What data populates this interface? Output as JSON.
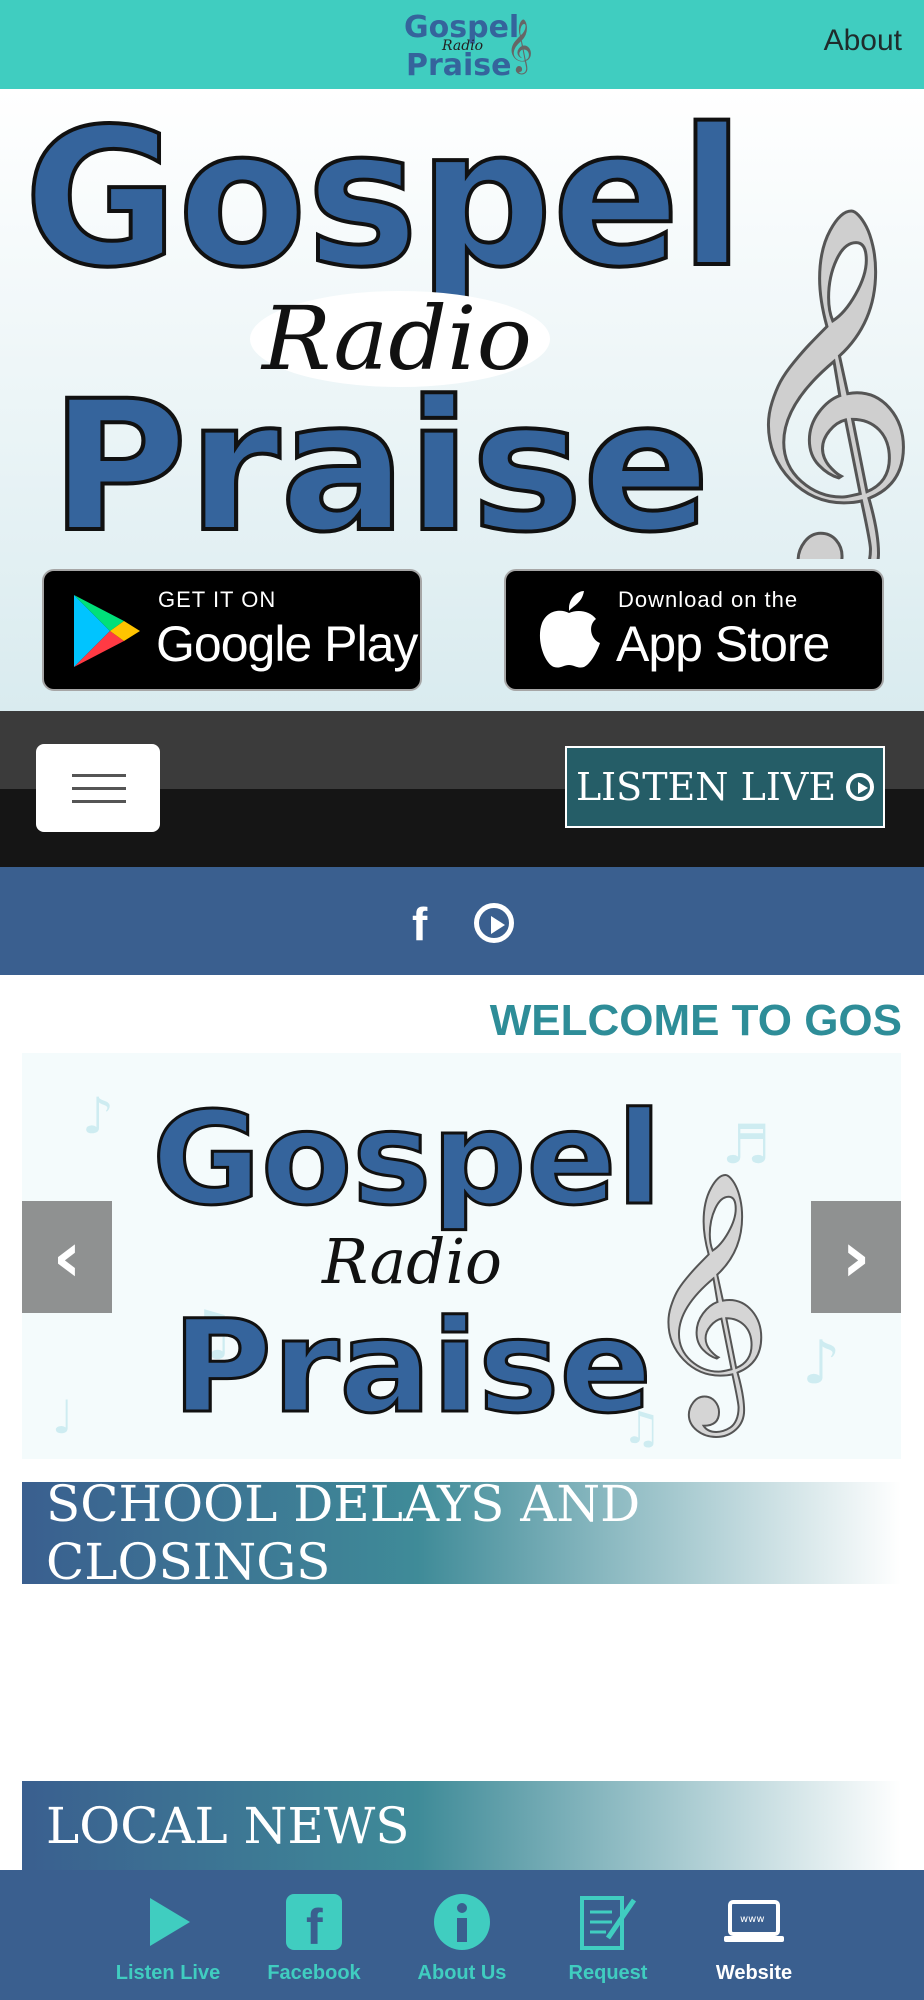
{
  "app": {
    "logo_text": [
      "Gospel",
      "Radio",
      "Praise"
    ],
    "about_label": "About"
  },
  "hero": {
    "logo_text": [
      "Gospel",
      "Radio",
      "Praise"
    ],
    "google_play": {
      "small": "GET IT ON",
      "big": "Google Play"
    },
    "app_store": {
      "small": "Download on the",
      "big": "App Store"
    }
  },
  "nav": {
    "menu_icon": "hamburger-icon",
    "listen_live_label": "LISTEN LIVE"
  },
  "social": {
    "icons": [
      "facebook-icon",
      "youtube-play-icon"
    ]
  },
  "welcome_text": "WELCOME TO GOS",
  "slider": {
    "logo_text": [
      "Gospel",
      "Radio",
      "Praise"
    ],
    "prev_icon": "chevron-left-icon",
    "next_icon": "chevron-right-icon"
  },
  "sections": [
    {
      "title": "SCHOOL DELAYS AND CLOSINGS"
    },
    {
      "title": "LOCAL NEWS"
    }
  ],
  "tabs": [
    {
      "label": "Listen Live",
      "icon": "play-icon",
      "active": false
    },
    {
      "label": "Facebook",
      "icon": "facebook-icon",
      "active": false
    },
    {
      "label": "About Us",
      "icon": "info-icon",
      "active": false
    },
    {
      "label": "Request",
      "icon": "edit-note-icon",
      "active": false
    },
    {
      "label": "Website",
      "icon": "laptop-www-icon",
      "active": true
    }
  ],
  "colors": {
    "teal": "#40cdc0",
    "brand_blue": "#3a5f8f",
    "dark_teal": "#255d67",
    "welcome_teal": "#2e8d98"
  }
}
